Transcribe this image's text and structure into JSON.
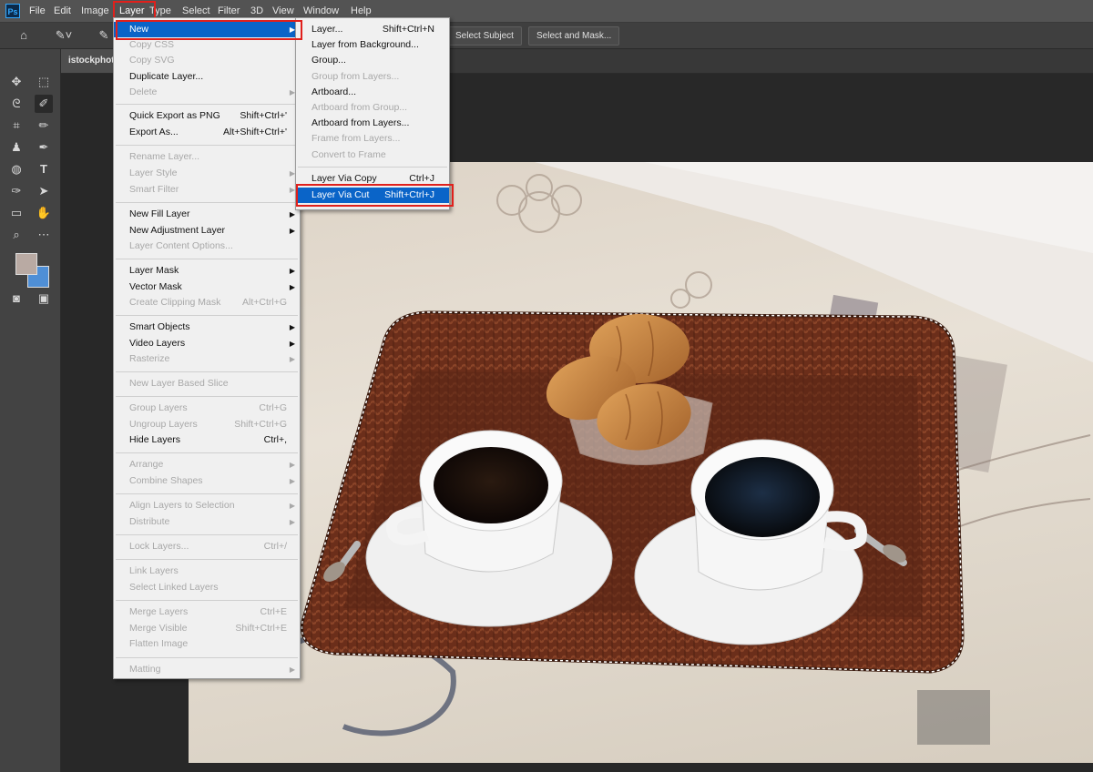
{
  "menubar": {
    "logo": "Ps",
    "items": [
      "File",
      "Edit",
      "Image",
      "Layer",
      "Type",
      "Select",
      "Filter",
      "3D",
      "View",
      "Window",
      "Help"
    ]
  },
  "options": {
    "select_subject": "Select Subject",
    "select_and_mask": "Select and Mask..."
  },
  "document": {
    "tab": "istockphoto"
  },
  "layer_menu": {
    "items": [
      {
        "label": "New",
        "shortcut": "",
        "submenu": true,
        "state": "highlight"
      },
      {
        "label": "Copy CSS",
        "shortcut": "",
        "submenu": false,
        "state": "disabled"
      },
      {
        "label": "Copy SVG",
        "shortcut": "",
        "submenu": false,
        "state": "disabled"
      },
      {
        "label": "Duplicate Layer...",
        "shortcut": "",
        "submenu": false,
        "state": "enabled"
      },
      {
        "label": "Delete",
        "shortcut": "",
        "submenu": true,
        "state": "disabled"
      },
      {
        "label": "Quick Export as PNG",
        "shortcut": "Shift+Ctrl+'",
        "submenu": false,
        "state": "enabled"
      },
      {
        "label": "Export As...",
        "shortcut": "Alt+Shift+Ctrl+'",
        "submenu": false,
        "state": "enabled"
      },
      {
        "label": "Rename Layer...",
        "shortcut": "",
        "submenu": false,
        "state": "disabled"
      },
      {
        "label": "Layer Style",
        "shortcut": "",
        "submenu": true,
        "state": "disabled"
      },
      {
        "label": "Smart Filter",
        "shortcut": "",
        "submenu": true,
        "state": "disabled"
      },
      {
        "label": "New Fill Layer",
        "shortcut": "",
        "submenu": true,
        "state": "enabled"
      },
      {
        "label": "New Adjustment Layer",
        "shortcut": "",
        "submenu": true,
        "state": "enabled"
      },
      {
        "label": "Layer Content Options...",
        "shortcut": "",
        "submenu": false,
        "state": "disabled"
      },
      {
        "label": "Layer Mask",
        "shortcut": "",
        "submenu": true,
        "state": "enabled"
      },
      {
        "label": "Vector Mask",
        "shortcut": "",
        "submenu": true,
        "state": "enabled"
      },
      {
        "label": "Create Clipping Mask",
        "shortcut": "Alt+Ctrl+G",
        "submenu": false,
        "state": "disabled"
      },
      {
        "label": "Smart Objects",
        "shortcut": "",
        "submenu": true,
        "state": "enabled"
      },
      {
        "label": "Video Layers",
        "shortcut": "",
        "submenu": true,
        "state": "enabled"
      },
      {
        "label": "Rasterize",
        "shortcut": "",
        "submenu": true,
        "state": "disabled"
      },
      {
        "label": "New Layer Based Slice",
        "shortcut": "",
        "submenu": false,
        "state": "disabled"
      },
      {
        "label": "Group Layers",
        "shortcut": "Ctrl+G",
        "submenu": false,
        "state": "disabled"
      },
      {
        "label": "Ungroup Layers",
        "shortcut": "Shift+Ctrl+G",
        "submenu": false,
        "state": "disabled"
      },
      {
        "label": "Hide Layers",
        "shortcut": "Ctrl+,",
        "submenu": false,
        "state": "enabled"
      },
      {
        "label": "Arrange",
        "shortcut": "",
        "submenu": true,
        "state": "disabled"
      },
      {
        "label": "Combine Shapes",
        "shortcut": "",
        "submenu": true,
        "state": "disabled"
      },
      {
        "label": "Align Layers to Selection",
        "shortcut": "",
        "submenu": true,
        "state": "disabled"
      },
      {
        "label": "Distribute",
        "shortcut": "",
        "submenu": true,
        "state": "disabled"
      },
      {
        "label": "Lock Layers...",
        "shortcut": "Ctrl+/",
        "submenu": false,
        "state": "disabled"
      },
      {
        "label": "Link Layers",
        "shortcut": "",
        "submenu": false,
        "state": "disabled"
      },
      {
        "label": "Select Linked Layers",
        "shortcut": "",
        "submenu": false,
        "state": "disabled"
      },
      {
        "label": "Merge Layers",
        "shortcut": "Ctrl+E",
        "submenu": false,
        "state": "disabled"
      },
      {
        "label": "Merge Visible",
        "shortcut": "Shift+Ctrl+E",
        "submenu": false,
        "state": "disabled"
      },
      {
        "label": "Flatten Image",
        "shortcut": "",
        "submenu": false,
        "state": "disabled"
      },
      {
        "label": "Matting",
        "shortcut": "",
        "submenu": true,
        "state": "disabled"
      }
    ]
  },
  "new_submenu": {
    "items": [
      {
        "label": "Layer...",
        "shortcut": "Shift+Ctrl+N",
        "state": "enabled"
      },
      {
        "label": "Layer from Background...",
        "shortcut": "",
        "state": "enabled"
      },
      {
        "label": "Group...",
        "shortcut": "",
        "state": "enabled"
      },
      {
        "label": "Group from Layers...",
        "shortcut": "",
        "state": "disabled"
      },
      {
        "label": "Artboard...",
        "shortcut": "",
        "state": "enabled"
      },
      {
        "label": "Artboard from Group...",
        "shortcut": "",
        "state": "disabled"
      },
      {
        "label": "Artboard from Layers...",
        "shortcut": "",
        "state": "enabled"
      },
      {
        "label": "Frame from Layers...",
        "shortcut": "",
        "state": "disabled"
      },
      {
        "label": "Convert to Frame",
        "shortcut": "",
        "state": "disabled"
      },
      {
        "label": "Layer Via Copy",
        "shortcut": "Ctrl+J",
        "state": "enabled"
      },
      {
        "label": "Layer Via Cut",
        "shortcut": "Shift+Ctrl+J",
        "state": "highlight"
      }
    ]
  },
  "colors": {
    "highlight": "#0a64c8",
    "annotation": "#e0201c",
    "foreground": "#b9aaa3",
    "background": "#4f8fd6"
  }
}
